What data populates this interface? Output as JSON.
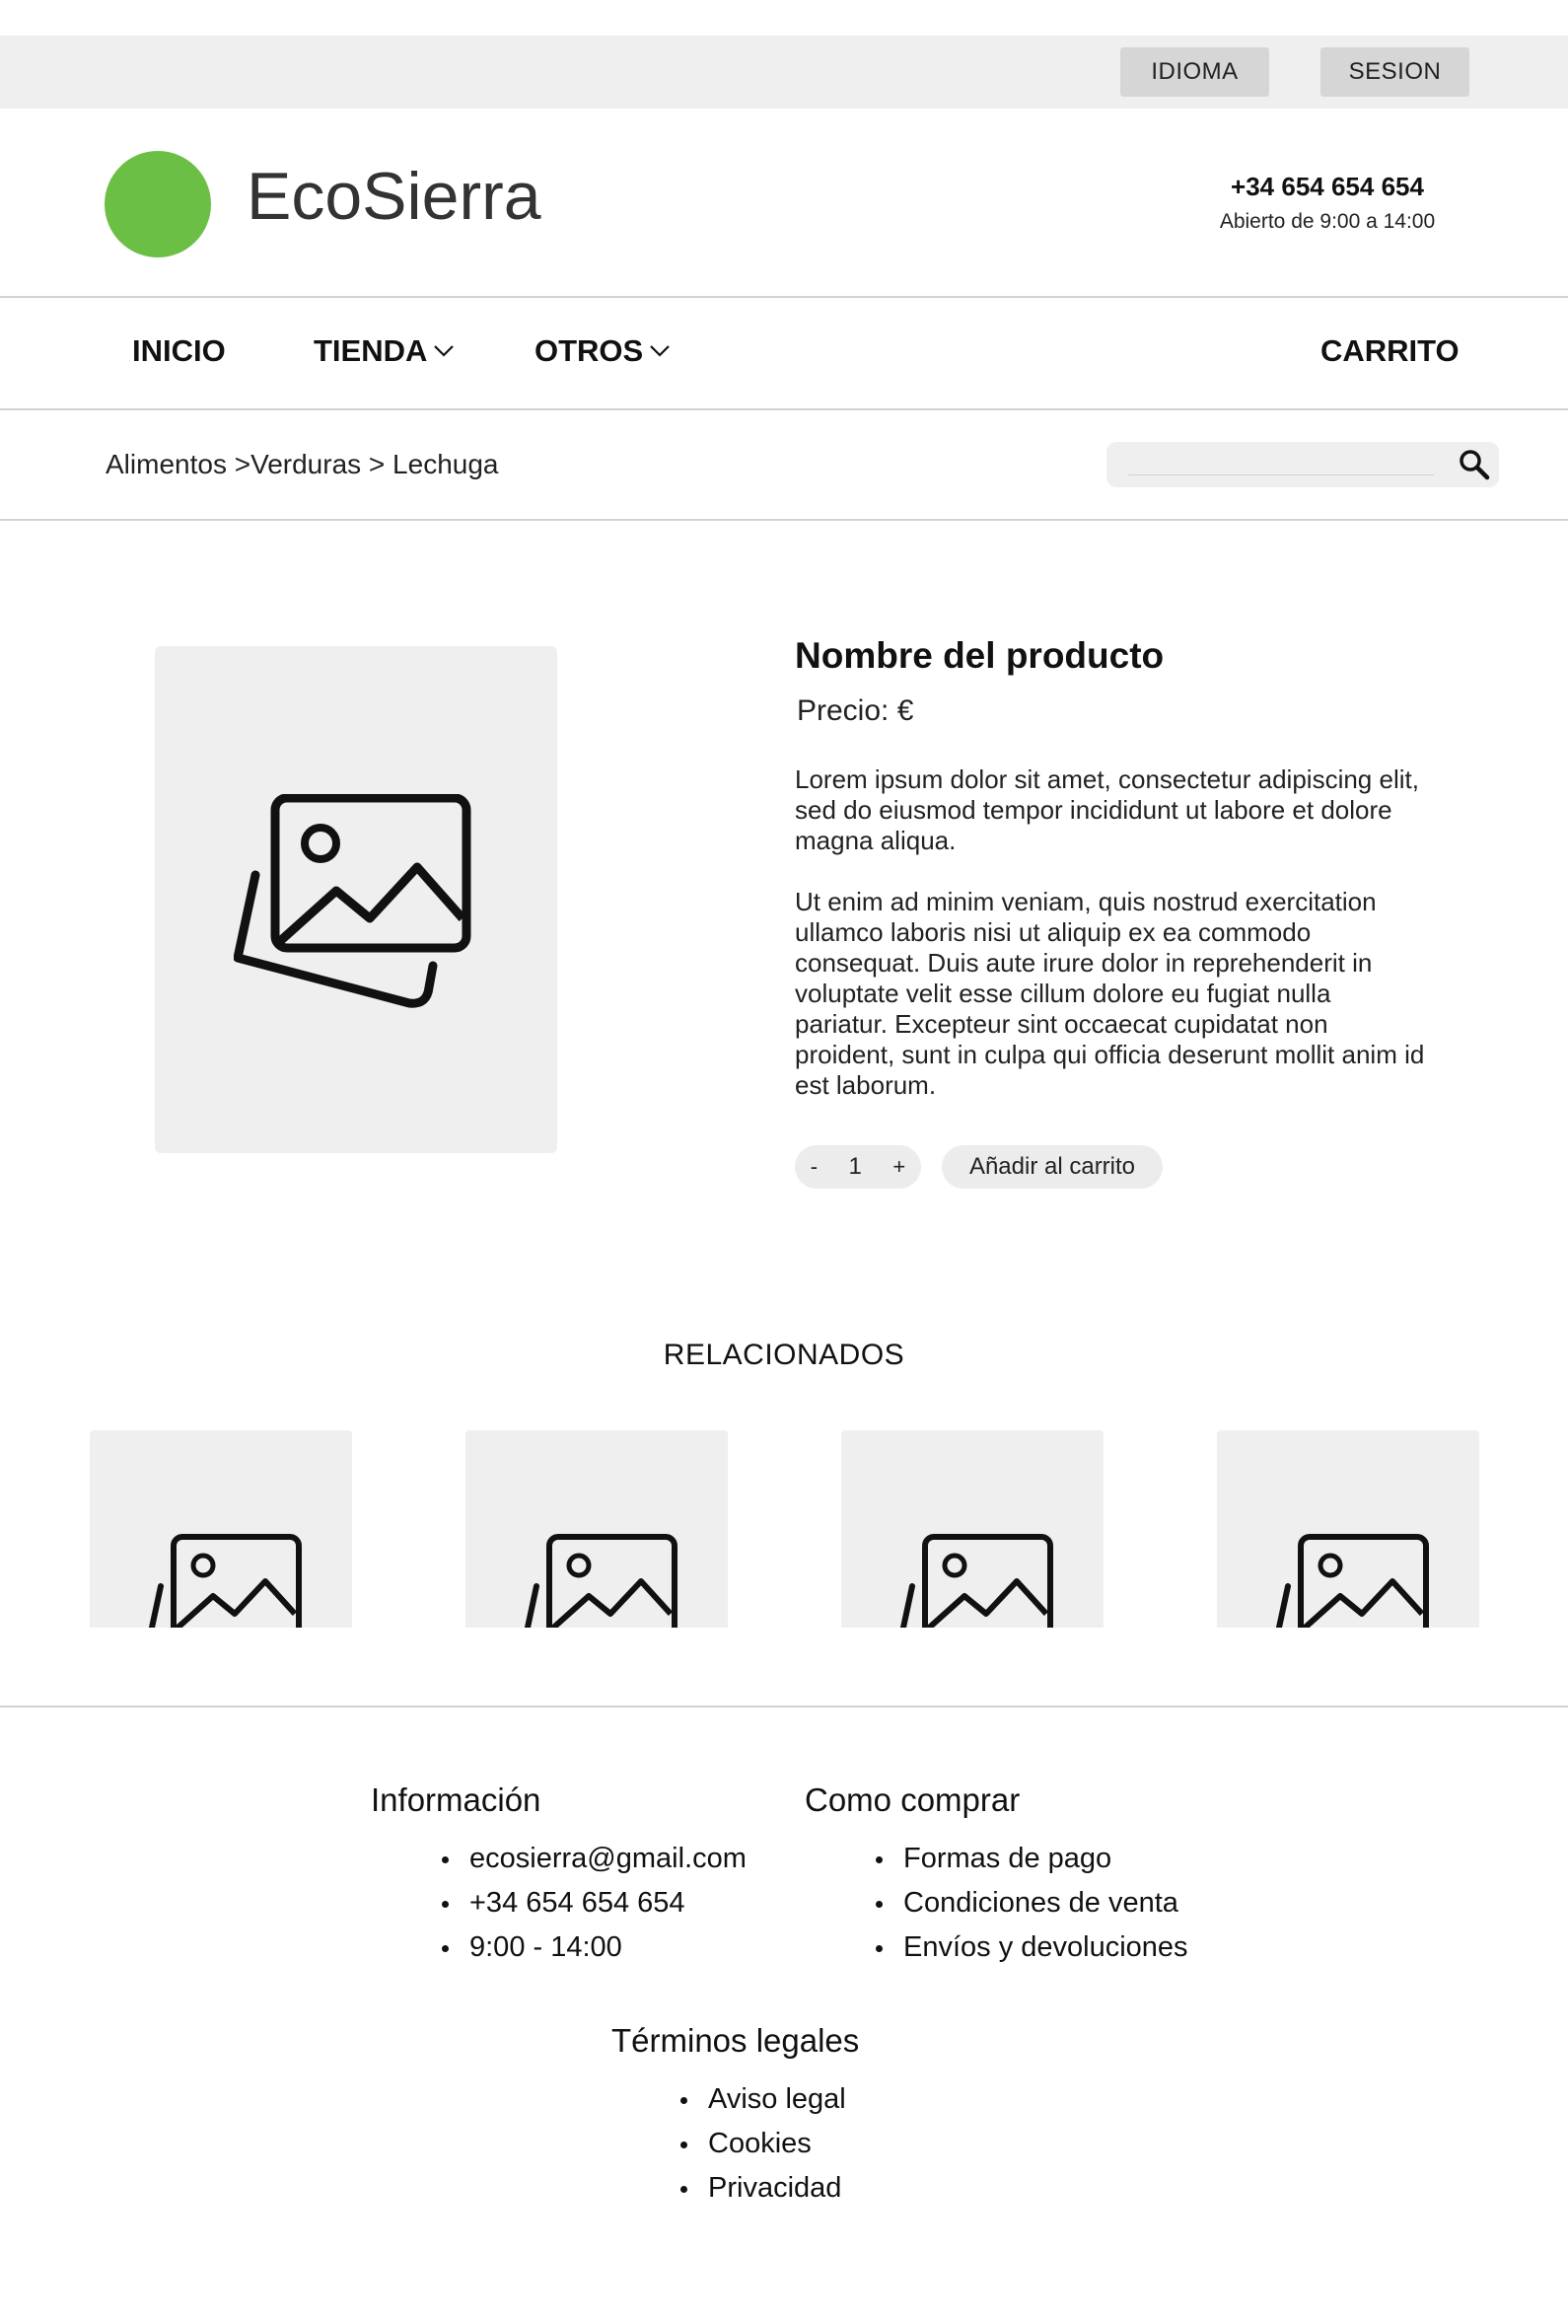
{
  "topbar": {
    "idioma_label": "IDIOMA",
    "sesion_label": "SESION"
  },
  "header": {
    "brand": "EcoSierra",
    "brand_color": "#6cbf45",
    "phone": "+34 654 654 654",
    "hours": "Abierto de 9:00 a 14:00"
  },
  "nav": {
    "inicio": "INICIO",
    "tienda": "TIENDA",
    "otros": "OTROS",
    "carrito": "CARRITO"
  },
  "breadcrumb": "Alimentos >Verduras > Lechuga",
  "search": {
    "placeholder": "",
    "icon": "search-icon"
  },
  "product": {
    "image_icon": "image-placeholder-icon",
    "title": "Nombre del producto",
    "price": "Precio: €",
    "description_1": "Lorem ipsum dolor sit amet, consectetur adipiscing elit, sed do eiusmod tempor incididunt ut labore et dolore magna aliqua.",
    "description_2": "Ut enim ad minim veniam, quis nostrud exercitation ullamco laboris nisi ut aliquip ex ea commodo consequat. Duis aute irure dolor in reprehenderit in voluptate velit esse cillum dolore eu fugiat nulla pariatur. Excepteur sint occaecat cupidatat non proident, sunt in culpa qui officia deserunt mollit anim id est laborum.",
    "qty_minus": "-",
    "qty_value": "1",
    "qty_plus": "+",
    "add_to_cart": "Añadir al carrito"
  },
  "related": {
    "title": "RELACIONADOS",
    "count_icon": "image-placeholder-icon"
  },
  "footer": {
    "info": {
      "title": "Información",
      "items": [
        "ecosierra@gmail.com",
        "+34 654 654 654",
        "9:00 - 14:00"
      ]
    },
    "buy": {
      "title": "Como comprar",
      "items": [
        "Formas de pago",
        "Condiciones de venta",
        "Envíos y devoluciones"
      ]
    },
    "legal": {
      "title": "Términos legales",
      "items": [
        "Aviso legal",
        "Cookies",
        "Privacidad"
      ]
    }
  }
}
